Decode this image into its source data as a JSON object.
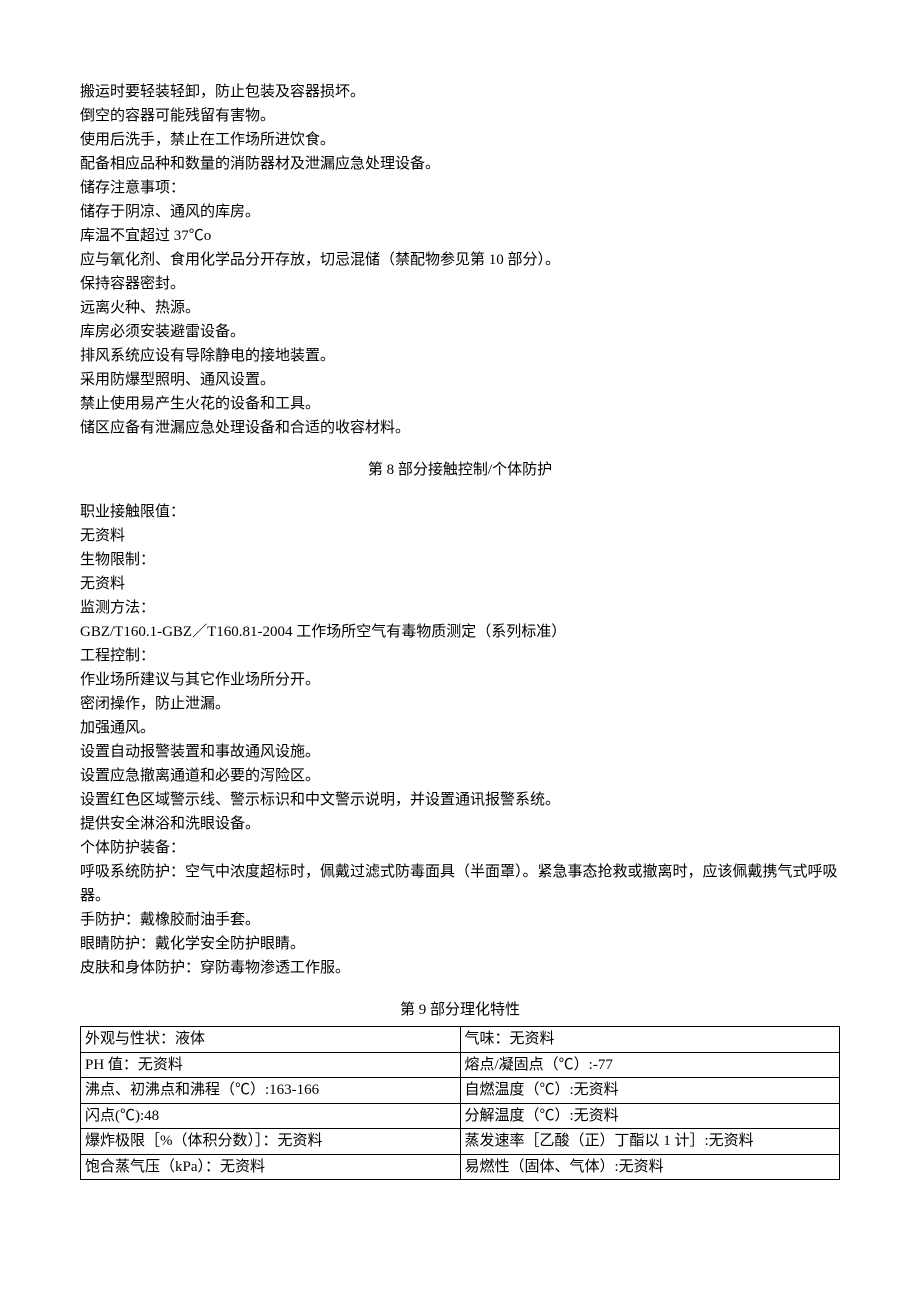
{
  "section7_lines": [
    "搬运时要轻装轻卸，防止包装及容器损坏。",
    "倒空的容器可能残留有害物。",
    "使用后洗手，禁止在工作场所进饮食。",
    "配备相应品种和数量的消防器材及泄漏应急处理设备。",
    "储存注意事项：",
    "储存于阴凉、通风的库房。",
    "库温不宜超过 37℃o",
    "应与氧化剂、食用化学品分开存放，切忌混储（禁配物参见第 10 部分）。",
    "保持容器密封。",
    "远离火种、热源。",
    "库房必须安装避雷设备。",
    "排风系统应设有导除静电的接地装置。",
    "采用防爆型照明、通风设置。",
    "禁止使用易产生火花的设备和工具。",
    "储区应备有泄漏应急处理设备和合适的收容材料。"
  ],
  "section8_title": "第 8 部分接触控制/个体防护",
  "section8_lines": [
    "职业接触限值：",
    "无资料",
    "生物限制：",
    "无资料",
    "监测方法：",
    "GBZ/T160.1-GBZ／T160.81-2004 工作场所空气有毒物质测定（系列标准）",
    "工程控制：",
    "作业场所建议与其它作业场所分开。",
    "密闭操作，防止泄漏。",
    "加强通风。",
    "设置自动报警装置和事故通风设施。",
    "设置应急撤离通道和必要的泻险区。",
    "设置红色区域警示线、警示标识和中文警示说明，并设置通讯报警系统。",
    "提供安全淋浴和洗眼设备。",
    "个体防护装备：",
    "呼吸系统防护：空气中浓度超标时，佩戴过滤式防毒面具（半面罩）。紧急事态抢救或撤离时，应该佩戴携气式呼吸器。",
    "手防护：戴橡胶耐油手套。",
    "眼睛防护：戴化学安全防护眼睛。",
    "皮肤和身体防护：穿防毒物渗透工作服。"
  ],
  "section9_title": "第 9 部分理化特性",
  "section9_table": [
    {
      "left": "外观与性状：液体",
      "right": "气味：无资料"
    },
    {
      "left": "PH 值：无资料",
      "right": "熔点/凝固点（℃）:-77"
    },
    {
      "left": "沸点、初沸点和沸程（℃）:163-166",
      "right": "自燃温度（℃）:无资料"
    },
    {
      "left": "闪点(℃):48",
      "right": "分解温度（℃）:无资料"
    },
    {
      "left": "爆炸极限［%（体积分数）］：无资料",
      "right": "蒸发速率［乙酸（正）丁酯以 1 计］:无资料"
    },
    {
      "left": "饱合蒸气压（kPa）：无资料",
      "right": "易燃性（固体、气体）:无资料"
    }
  ]
}
